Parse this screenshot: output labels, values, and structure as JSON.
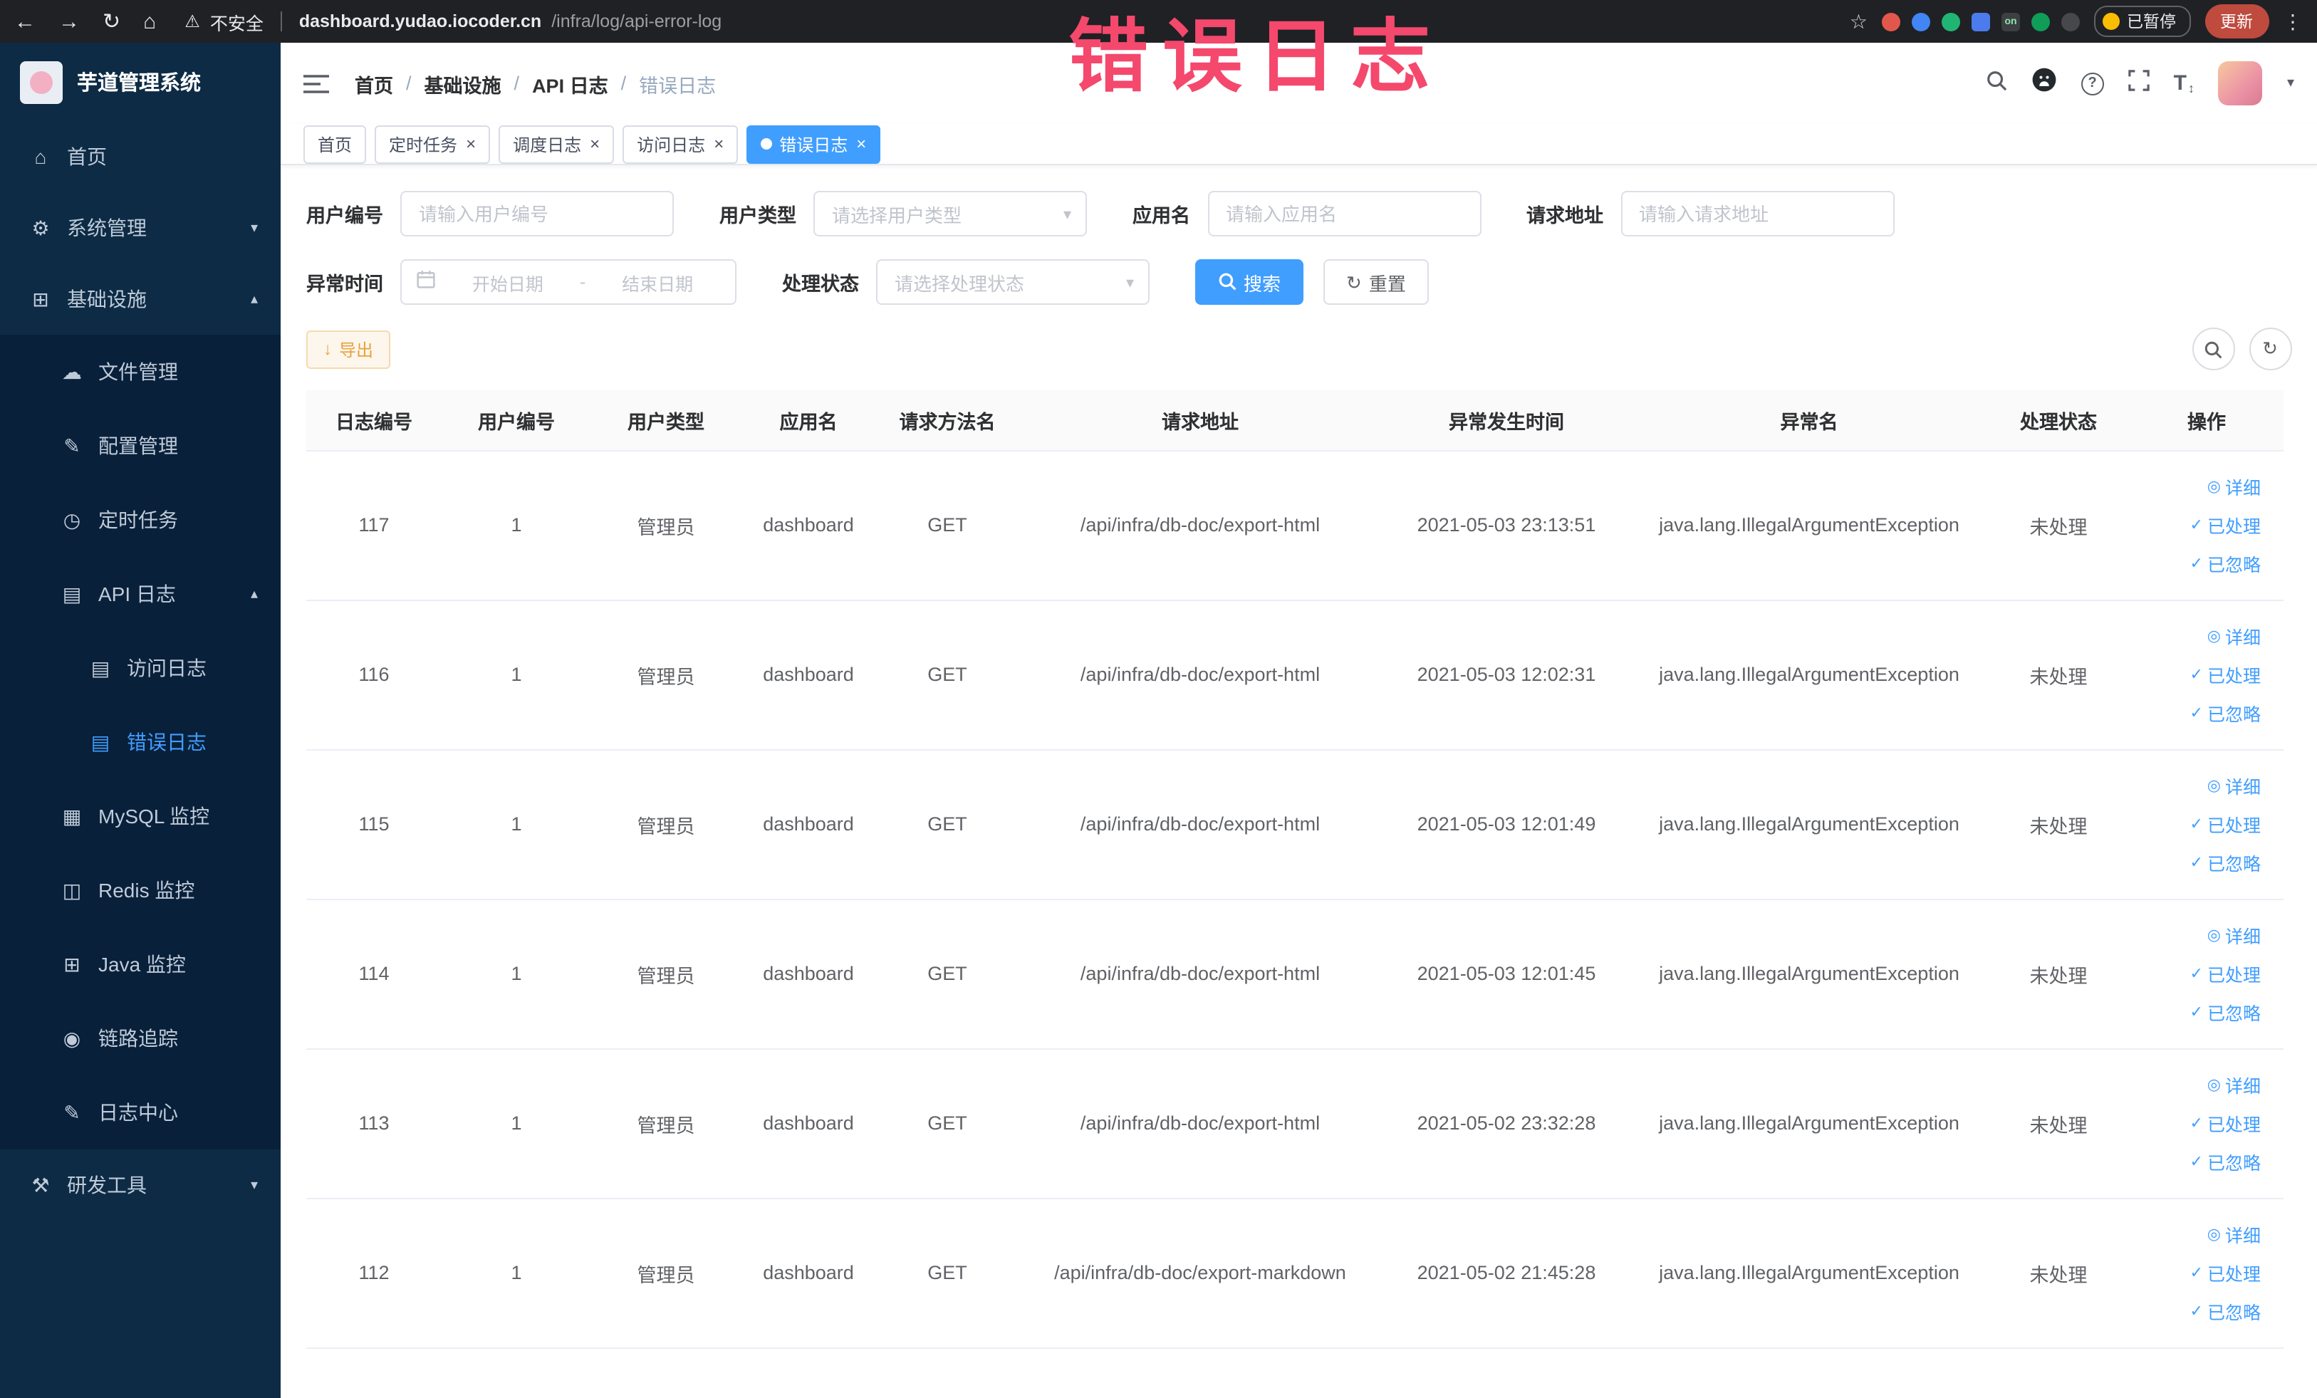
{
  "browser": {
    "security_label": "不安全",
    "url_host": "dashboard.yudao.iocoder.cn",
    "url_path": "/infra/log/api-error-log",
    "paused_badge": "已暂停",
    "update_button": "更新",
    "extensions": [
      {
        "name": "extension-red",
        "color": "#e2574c",
        "shape": "circle",
        "text": ""
      },
      {
        "name": "extension-blue",
        "color": "#4285f4",
        "shape": "circle",
        "text": ""
      },
      {
        "name": "extension-green",
        "color": "#21b573",
        "shape": "circle",
        "text": ""
      },
      {
        "name": "extension-blue-square",
        "color": "#4b7bec",
        "shape": "square",
        "text": ""
      },
      {
        "name": "extension-on-badge",
        "color": "#3c4043",
        "shape": "square",
        "text": "on"
      },
      {
        "name": "extension-dark-green",
        "color": "#0f9d58",
        "shape": "circle",
        "text": ""
      },
      {
        "name": "extension-dark",
        "color": "#46484b",
        "shape": "circle",
        "text": ""
      }
    ]
  },
  "annotation": {
    "text": "错误日志",
    "color": "#f4486d"
  },
  "sidebar": {
    "logo_title": "芋道管理系统",
    "items": [
      {
        "name": "home",
        "icon": "home",
        "label": "首页",
        "level": 0
      },
      {
        "name": "system-management",
        "icon": "gear",
        "label": "系统管理",
        "level": 0,
        "chevron": "down"
      },
      {
        "name": "infrastructure",
        "icon": "monitor",
        "label": "基础设施",
        "level": 0,
        "chevron": "up"
      },
      {
        "name": "file-management",
        "icon": "cloud",
        "label": "文件管理",
        "level": 1,
        "sub": true
      },
      {
        "name": "config-management",
        "icon": "edit",
        "label": "配置管理",
        "level": 1,
        "sub": true
      },
      {
        "name": "scheduled-tasks",
        "icon": "timer",
        "label": "定时任务",
        "level": 1,
        "sub": true
      },
      {
        "name": "api-logs",
        "icon": "document",
        "label": "API 日志",
        "level": 1,
        "sub": true,
        "chevron": "up"
      },
      {
        "name": "access-logs",
        "icon": "document",
        "label": "访问日志",
        "level": 2,
        "sub": true
      },
      {
        "name": "error-logs",
        "icon": "document",
        "label": "错误日志",
        "level": 2,
        "sub": true,
        "active": true
      },
      {
        "name": "mysql-monitor",
        "icon": "grid",
        "label": "MySQL 监控",
        "level": 1,
        "sub": true
      },
      {
        "name": "redis-monitor",
        "icon": "layers",
        "label": "Redis 监控",
        "level": 1,
        "sub": true
      },
      {
        "name": "java-monitor",
        "icon": "monitor",
        "label": "Java 监控",
        "level": 1,
        "sub": true
      },
      {
        "name": "link-tracing",
        "icon": "eye",
        "label": "链路追踪",
        "level": 1,
        "sub": true
      },
      {
        "name": "log-center",
        "icon": "edit",
        "label": "日志中心",
        "level": 1,
        "sub": true
      },
      {
        "name": "dev-tools",
        "icon": "tools",
        "label": "研发工具",
        "level": 0,
        "chevron": "down"
      }
    ]
  },
  "header": {
    "breadcrumb": [
      "首页",
      "基础设施",
      "API 日志",
      "错误日志"
    ]
  },
  "tabs": [
    {
      "label": "首页",
      "closable": false,
      "active": false
    },
    {
      "label": "定时任务",
      "closable": true,
      "active": false
    },
    {
      "label": "调度日志",
      "closable": true,
      "active": false
    },
    {
      "label": "访问日志",
      "closable": true,
      "active": false
    },
    {
      "label": "错误日志",
      "closable": true,
      "active": true
    }
  ],
  "filters": {
    "user_id": {
      "label": "用户编号",
      "placeholder": "请输入用户编号"
    },
    "user_type": {
      "label": "用户类型",
      "placeholder": "请选择用户类型"
    },
    "app_name": {
      "label": "应用名",
      "placeholder": "请输入应用名"
    },
    "request_url": {
      "label": "请求地址",
      "placeholder": "请输入请求地址"
    },
    "exception_time": {
      "label": "异常时间",
      "start_placeholder": "开始日期",
      "separator": "-",
      "end_placeholder": "结束日期"
    },
    "process_status": {
      "label": "处理状态",
      "placeholder": "请选择处理状态"
    },
    "search_button": "搜索",
    "reset_button": "重置"
  },
  "toolbar": {
    "export_button": "导出"
  },
  "table": {
    "columns": [
      "日志编号",
      "用户编号",
      "用户类型",
      "应用名",
      "请求方法名",
      "请求地址",
      "异常发生时间",
      "异常名",
      "处理状态",
      "操作"
    ],
    "row_actions": [
      "详细",
      "已处理",
      "已忽略"
    ],
    "rows": [
      {
        "id": "117",
        "user_id": "1",
        "user_type": "管理员",
        "app_name": "dashboard",
        "method": "GET",
        "url": "/api/infra/db-doc/export-html",
        "time": "2021-05-03 23:13:51",
        "exception": "java.lang.IllegalArgumentException",
        "status": "未处理"
      },
      {
        "id": "116",
        "user_id": "1",
        "user_type": "管理员",
        "app_name": "dashboard",
        "method": "GET",
        "url": "/api/infra/db-doc/export-html",
        "time": "2021-05-03 12:02:31",
        "exception": "java.lang.IllegalArgumentException",
        "status": "未处理"
      },
      {
        "id": "115",
        "user_id": "1",
        "user_type": "管理员",
        "app_name": "dashboard",
        "method": "GET",
        "url": "/api/infra/db-doc/export-html",
        "time": "2021-05-03 12:01:49",
        "exception": "java.lang.IllegalArgumentException",
        "status": "未处理"
      },
      {
        "id": "114",
        "user_id": "1",
        "user_type": "管理员",
        "app_name": "dashboard",
        "method": "GET",
        "url": "/api/infra/db-doc/export-html",
        "time": "2021-05-03 12:01:45",
        "exception": "java.lang.IllegalArgumentException",
        "status": "未处理"
      },
      {
        "id": "113",
        "user_id": "1",
        "user_type": "管理员",
        "app_name": "dashboard",
        "method": "GET",
        "url": "/api/infra/db-doc/export-html",
        "time": "2021-05-02 23:32:28",
        "exception": "java.lang.IllegalArgumentException",
        "status": "未处理"
      },
      {
        "id": "112",
        "user_id": "1",
        "user_type": "管理员",
        "app_name": "dashboard",
        "method": "GET",
        "url": "/api/infra/db-doc/export-markdown",
        "time": "2021-05-02 21:45:28",
        "exception": "java.lang.IllegalArgumentException",
        "status": "未处理"
      }
    ]
  }
}
